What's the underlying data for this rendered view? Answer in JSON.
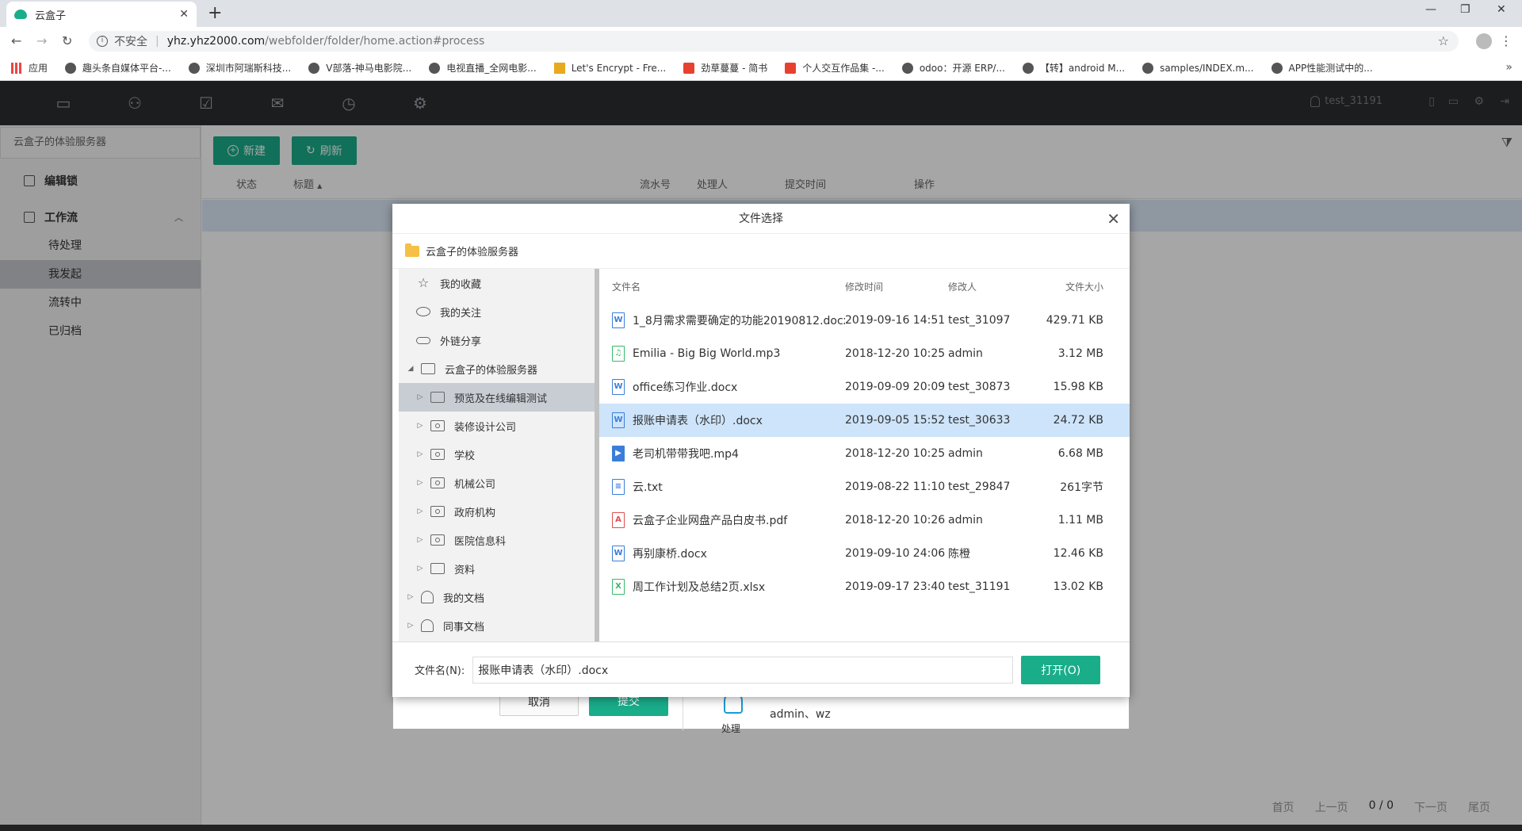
{
  "browser": {
    "tab_title": "云盒子",
    "tab_close": "✕",
    "new_tab": "+",
    "insecure_label": "不安全",
    "url_host": "yhz.yhz2000.com",
    "url_path": "/webfolder/folder/home.action#process",
    "bookmarks": [
      {
        "label": "应用",
        "icon": "apps-icon"
      },
      {
        "label": "趣头条自媒体平台-...",
        "icon": "globe-icon"
      },
      {
        "label": "深圳市阿瑞斯科技...",
        "icon": "globe-icon"
      },
      {
        "label": "V部落-神马电影院...",
        "icon": "globe-icon"
      },
      {
        "label": "电视直播_全网电影...",
        "icon": "globe-icon"
      },
      {
        "label": "Let's Encrypt - Fre...",
        "icon": "lock-icon"
      },
      {
        "label": "劲草蔓蔓 - 简书",
        "icon": "jianshu-icon"
      },
      {
        "label": "个人交互作品集 -...",
        "icon": "jianshu-icon"
      },
      {
        "label": "odoo：开源 ERP/...",
        "icon": "bird-icon"
      },
      {
        "label": "【转】android M...",
        "icon": "bird-icon"
      },
      {
        "label": "samples/INDEX.m...",
        "icon": "github-icon"
      },
      {
        "label": "APP性能测试中的...",
        "icon": "bird-icon"
      }
    ]
  },
  "app": {
    "username": "test_31191",
    "server_name": "云盒子的体验服务器",
    "sidebar": {
      "lock_label": "编辑锁",
      "workflow_label": "工作流",
      "items": [
        "待处理",
        "我发起",
        "流转中",
        "已归档"
      ],
      "active_index": 1
    },
    "toolbar": {
      "new_label": "新建",
      "refresh_label": "刷新"
    },
    "table_headers": [
      "状态",
      "标题",
      "流水号",
      "处理人",
      "提交时间",
      "操作"
    ],
    "sort_indicator": "▲",
    "pager": {
      "first": "首页",
      "prev": "上一页",
      "count": "0 / 0",
      "next": "下一页",
      "last": "尾页"
    }
  },
  "under_modal": {
    "cancel_label": "取消",
    "submit_label": "提交",
    "assignees": "admin、wz",
    "cut_label": "处理"
  },
  "dialog": {
    "title": "文件选择",
    "close": "✕",
    "path": "云盒子的体验服务器",
    "tree": [
      {
        "label": "我的收藏",
        "icon": "star-icon",
        "arrow": ""
      },
      {
        "label": "我的关注",
        "icon": "eye-icon",
        "arrow": ""
      },
      {
        "label": "外链分享",
        "icon": "link-icon",
        "arrow": ""
      },
      {
        "label": "云盒子的体验服务器",
        "icon": "folder-icon",
        "arrow": "◢"
      },
      {
        "label": "预览及在线编辑测试",
        "icon": "folder-icon",
        "arrow": "▷"
      },
      {
        "label": "装修设计公司",
        "icon": "shared-folder-icon",
        "arrow": "▷"
      },
      {
        "label": "学校",
        "icon": "shared-folder-icon",
        "arrow": "▷"
      },
      {
        "label": "机械公司",
        "icon": "shared-folder-icon",
        "arrow": "▷"
      },
      {
        "label": "政府机构",
        "icon": "shared-folder-icon",
        "arrow": "▷"
      },
      {
        "label": "医院信息科",
        "icon": "shared-folder-icon",
        "arrow": "▷"
      },
      {
        "label": "资料",
        "icon": "folder-icon",
        "arrow": "▷"
      },
      {
        "label": "我的文档",
        "icon": "person-icon",
        "arrow": "▷"
      },
      {
        "label": "同事文档",
        "icon": "person-icon",
        "arrow": "▷"
      }
    ],
    "tree_selected_index": 4,
    "columns": {
      "name": "文件名",
      "time": "修改时间",
      "user": "修改人",
      "size": "文件大小"
    },
    "files": [
      {
        "name": "1_8月需求需要确定的功能20190812.docx",
        "time": "2019-09-16 14:51",
        "user": "test_31097",
        "size": "429.71 KB",
        "type": "word",
        "glyph": "W"
      },
      {
        "name": "Emilia - Big Big World.mp3",
        "time": "2018-12-20 10:25",
        "user": "admin",
        "size": "3.12 MB",
        "type": "audio",
        "glyph": "♫"
      },
      {
        "name": "office练习作业.docx",
        "time": "2019-09-09 20:09",
        "user": "test_30873",
        "size": "15.98 KB",
        "type": "word",
        "glyph": "W"
      },
      {
        "name": "报账申请表（水印）.docx",
        "time": "2019-09-05 15:52",
        "user": "test_30633",
        "size": "24.72 KB",
        "type": "word",
        "glyph": "W"
      },
      {
        "name": "老司机带带我吧.mp4",
        "time": "2018-12-20 10:25",
        "user": "admin",
        "size": "6.68 MB",
        "type": "video",
        "glyph": "▶"
      },
      {
        "name": "云.txt",
        "time": "2019-08-22 11:10",
        "user": "test_29847",
        "size": "261字节",
        "type": "txt",
        "glyph": "≡"
      },
      {
        "name": "云盒子企业网盘产品白皮书.pdf",
        "time": "2018-12-20 10:26",
        "user": "admin",
        "size": "1.11 MB",
        "type": "pdf",
        "glyph": "A"
      },
      {
        "name": "再别康桥.docx",
        "time": "2019-09-10 24:06",
        "user": "陈橙",
        "size": "12.46 KB",
        "type": "word",
        "glyph": "W"
      },
      {
        "name": "周工作计划及总结2页.xlsx",
        "time": "2019-09-17 23:40",
        "user": "test_31191",
        "size": "13.02 KB",
        "type": "xls",
        "glyph": "X"
      }
    ],
    "selected_file_index": 3,
    "filename_label": "文件名(N):",
    "filename_value": "报账申请表（水印）.docx",
    "open_label": "打开(O)"
  }
}
